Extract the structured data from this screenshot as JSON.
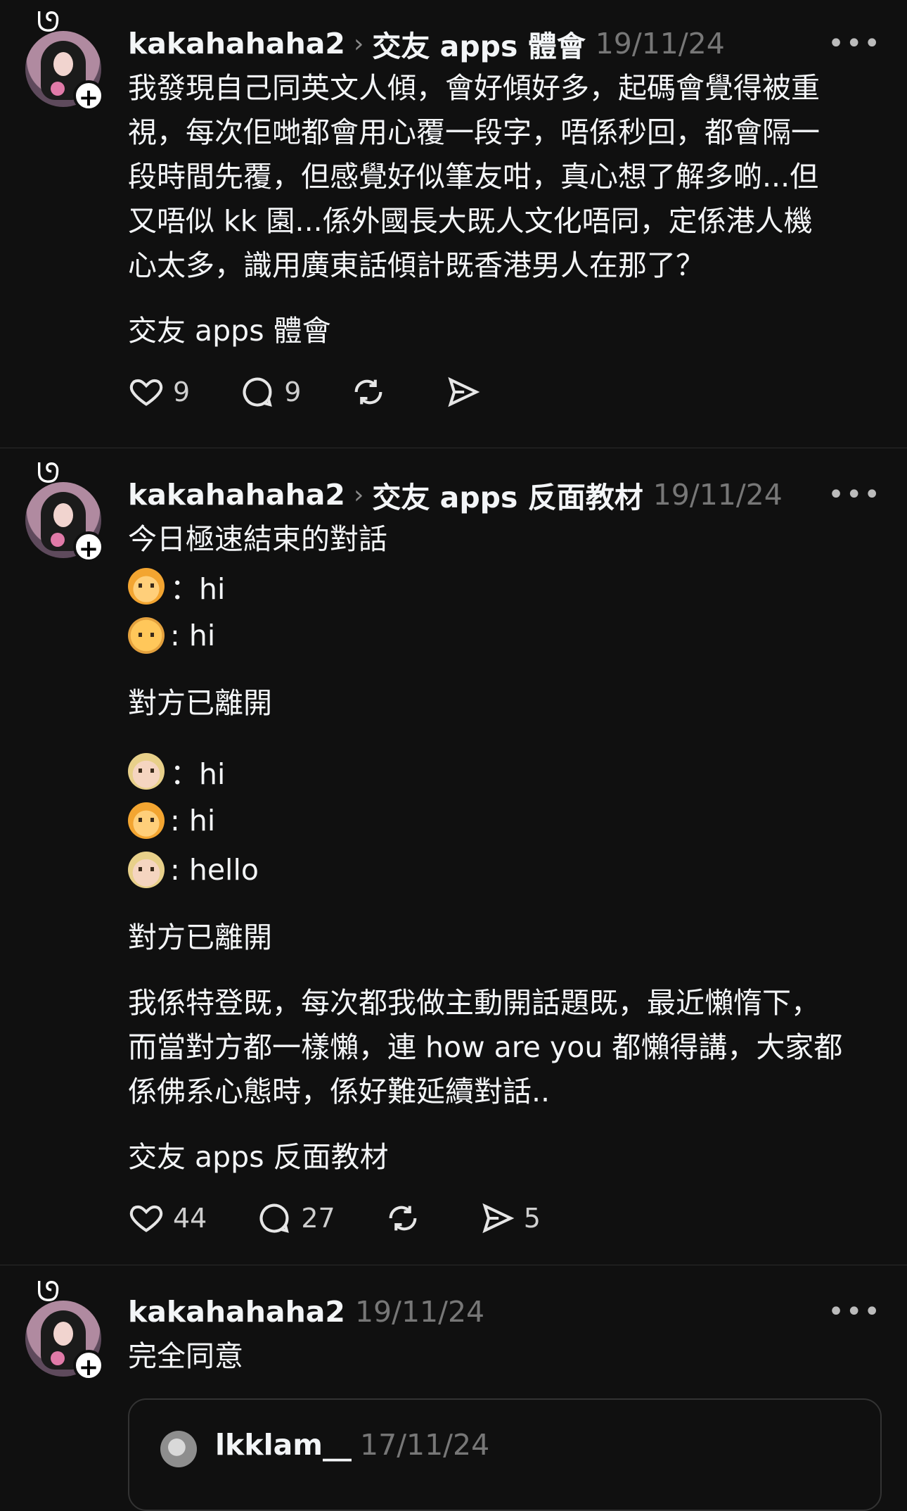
{
  "posts": [
    {
      "username": "kakahahaha2",
      "topic": "交友 apps 體會",
      "timestamp": "19/11/24",
      "more": "•••",
      "lines": [
        "我發現自己同英文人傾，會好傾好多，起碼會覺得被重",
        "視，每次佢哋都會用心覆一段字，唔係秒回，都會隔一",
        "段時間先覆，但感覺好似筆友咁，真心想了解多啲...但",
        "又唔似 kk 園...係外國長大既人文化唔同，定係港人機",
        "心太多，識用廣東話傾計既香港男人在那了？"
      ],
      "tag": "交友 apps 體會",
      "likes": "9",
      "comments": "9",
      "reposts": "",
      "shares": ""
    },
    {
      "username": "kakahahaha2",
      "topic": "交友 apps 反面教材",
      "timestamp": "19/11/24",
      "more": "•••",
      "intro": "今日極速結束的對話",
      "chat1": [
        {
          "emoji": "woman",
          "text": "：hi"
        },
        {
          "emoji": "man-old",
          "text": ": hi"
        }
      ],
      "left1": "對方已離開",
      "chat2": [
        {
          "emoji": "man-blond",
          "text": "：hi"
        },
        {
          "emoji": "woman",
          "text": ": hi"
        },
        {
          "emoji": "man-blond",
          "text": ": hello"
        }
      ],
      "left2": "對方已離開",
      "lines": [
        "我係特登既，每次都我做主動開話題既，最近懶惰下，",
        "而當對方都一樣懶，連 how are you 都懶得講，大家都",
        "係佛系心態時，係好難延續對話.."
      ],
      "tag": "交友 apps 反面教材",
      "likes": "44",
      "comments": "27",
      "reposts": "",
      "shares": "5"
    },
    {
      "username": "kakahahaha2",
      "timestamp": "19/11/24",
      "more": "•••",
      "text": "完全同意",
      "quote": {
        "username": "lkklam__",
        "timestamp": "17/11/24"
      }
    }
  ],
  "icons": {
    "like": "heart-icon",
    "comment": "comment-bubble-icon",
    "repost": "repost-icon",
    "share": "send-icon",
    "badge": "plus-icon"
  }
}
